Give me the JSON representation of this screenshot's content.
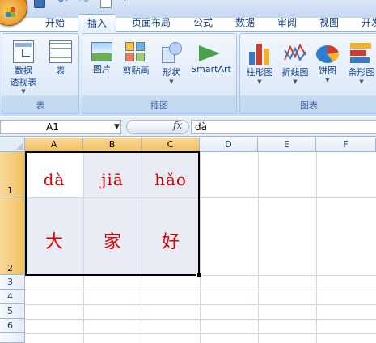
{
  "tabs": [
    "开始",
    "插入",
    "页面布局",
    "公式",
    "数据",
    "审阅",
    "视图",
    "开发"
  ],
  "active_tab": "插入",
  "ribbon": {
    "table_group": {
      "label": "表",
      "pivot_label_1": "数据",
      "pivot_label_2": "透视表",
      "table_label": "表"
    },
    "illustrations_group": {
      "label": "插图",
      "picture": "图片",
      "clipart": "剪贴画",
      "shapes": "形状",
      "smartart": "SmartArt"
    },
    "charts_group": {
      "label": "图表",
      "column": "柱形图",
      "line": "折线图",
      "pie": "饼图",
      "bar": "条形图"
    }
  },
  "formula_bar": {
    "name_box": "A1",
    "fx": "fx",
    "content": "dà"
  },
  "columns": [
    "A",
    "B",
    "C",
    "D",
    "E",
    "F"
  ],
  "rows": [
    "1",
    "2",
    "3",
    "4",
    "5",
    "6"
  ],
  "cells": {
    "A1": "dà",
    "B1": "jiā",
    "C1": "hǎo",
    "A2": "大",
    "B2": "家",
    "C2": "好"
  },
  "colors": {
    "cell_text": "#e00000",
    "selection_fill": "#e9ebf5",
    "header_selected": "#f1c15f"
  }
}
